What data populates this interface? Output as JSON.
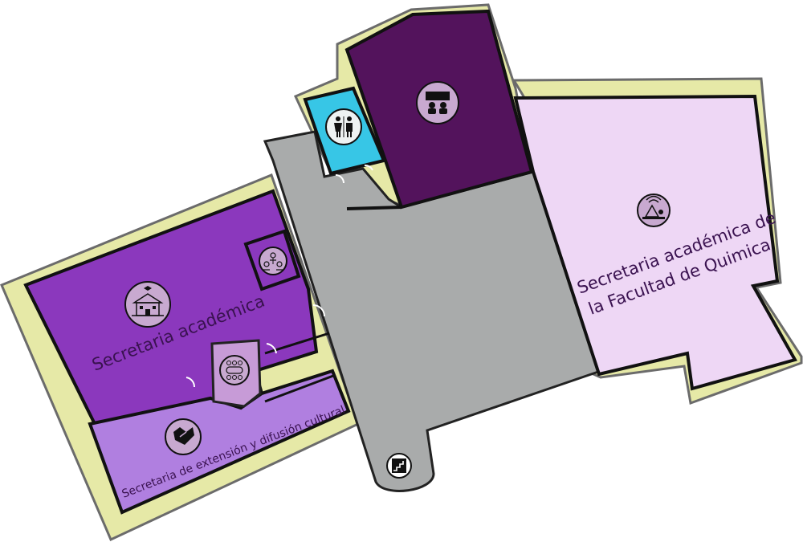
{
  "map": {
    "colors": {
      "outer_shell": "#e6e9a7",
      "outline": "#111111",
      "academica": "#8b38bd",
      "extension": "#b07fe0",
      "quimica": "#eed7f5",
      "auditorio": "#53135c",
      "banos": "#37c6e6",
      "corridor": "#a9abab",
      "small_room": "#c79bd7",
      "icon_circle": "#c8a9d0"
    },
    "rooms": {
      "academica": {
        "label": "Secretaria académica",
        "icon": "school-building-icon"
      },
      "extension": {
        "label": "Secretaria de extensión y difusión cultural",
        "icon": "handshake-icon"
      },
      "quimica": {
        "label_line1": "Secretaria académica de",
        "label_line2": "la Facultad de Quimica",
        "icon": "chemistry-lab-icon"
      },
      "auditorio": {
        "icon": "presentation-screen-icon"
      },
      "banos": {
        "icon": "restroom-icon"
      },
      "sala_juntas": {
        "icon": "meeting-table-icon"
      },
      "oficina": {
        "icon": "people-network-icon"
      },
      "escalera": {
        "icon": "stairs-icon"
      }
    }
  }
}
